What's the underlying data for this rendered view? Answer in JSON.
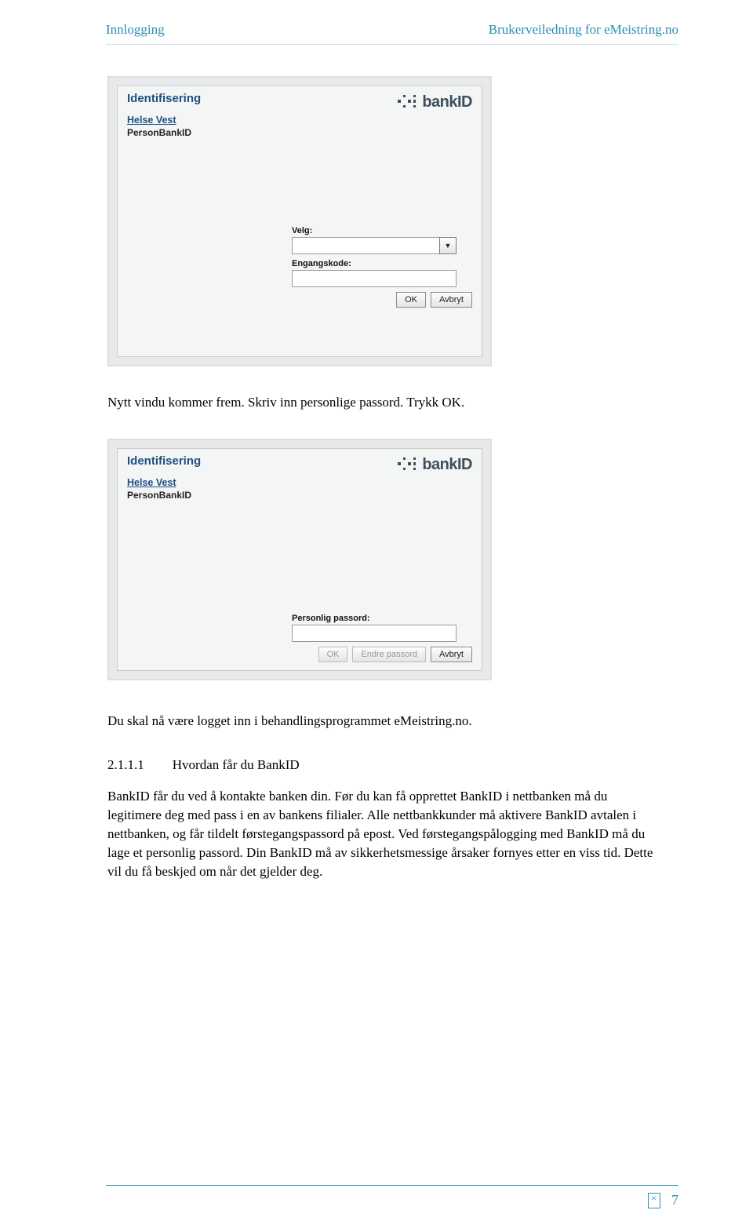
{
  "header": {
    "left": "Innlogging",
    "right": "Brukerveiledning for eMeistring.no"
  },
  "bankid_window1": {
    "title": "Identifisering",
    "org_link": "Helse Vest",
    "sub": "PersonBankID",
    "logo_text": "bankID",
    "select_label": "Velg:",
    "code_label": "Engangskode:",
    "ok_label": "OK",
    "cancel_label": "Avbryt"
  },
  "text_mid1": "Nytt vindu kommer frem. Skriv inn personlige passord. Trykk OK.",
  "bankid_window2": {
    "title": "Identifisering",
    "org_link": "Helse Vest",
    "sub": "PersonBankID",
    "logo_text": "bankID",
    "pw_label": "Personlig passord:",
    "ok_label": "OK",
    "change_label": "Endre passord",
    "cancel_label": "Avbryt"
  },
  "text_mid2": "Du skal nå være logget inn i behandlingsprogrammet eMeistring.no.",
  "section": {
    "number": "2.1.1.1",
    "title": "Hvordan får du BankID",
    "body": "BankID får du ved å kontakte banken din. Før du kan få opprettet BankID i nettbanken må du legitimere deg med pass i en av bankens filialer. Alle nettbankkunder må aktivere BankID avtalen i nettbanken, og får tildelt førstegangspassord på epost. Ved førstegangspålogging med BankID må du lage et personlig passord. Din BankID må av sikkerhetsmessige årsaker fornyes etter en viss tid. Dette vil du få beskjed om når det gjelder deg."
  },
  "page_number": "7"
}
